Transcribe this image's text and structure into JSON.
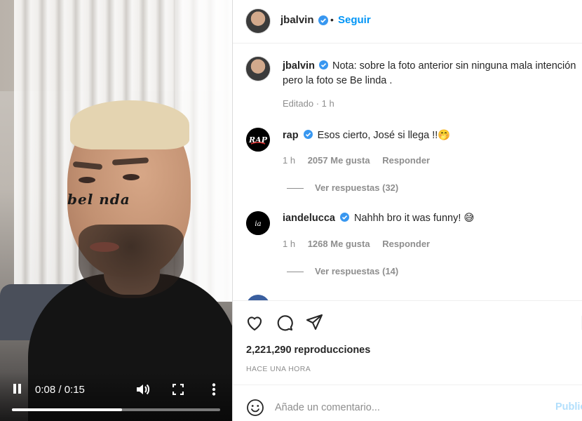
{
  "video": {
    "time_label": "0:08 / 0:15",
    "progress": 0.53,
    "face_text": "bel  nda"
  },
  "header": {
    "username": "jbalvin",
    "separator": "•",
    "follow_label": "Seguir"
  },
  "caption": {
    "username": "jbalvin",
    "text": "Nota: sobre la foto anterior sin ninguna mala intención pero la foto se Be linda .",
    "meta": "Editado · 1 h"
  },
  "comments": [
    {
      "username": "rap",
      "text": "Esos cierto, José si llega !!🤭",
      "time": "1 h",
      "likes": "2057 Me gusta",
      "reply_label": "Responder",
      "view_replies": "Ver respuestas (32)",
      "avatar_text": "RAP"
    },
    {
      "username": "iandelucca",
      "text": "Nahhh bro it was funny! 😅",
      "time": "1 h",
      "likes": "1268 Me gusta",
      "reply_label": "Responder",
      "view_replies": "Ver respuestas (14)",
      "avatar_text": "ia"
    }
  ],
  "stats": {
    "views": "2,221,290 reproducciones",
    "posted": "HACE UNA HORA"
  },
  "add_comment": {
    "placeholder": "Añade un comentario...",
    "publish_label": "Publicar"
  },
  "colors": {
    "link_blue": "#0095f6",
    "verified_blue": "#3897f0",
    "muted": "#8e8e8e",
    "publish_disabled": "#b2dffc"
  },
  "icons": [
    "play-pause-icon",
    "volume-icon",
    "fullscreen-icon",
    "more-vertical-icon",
    "verified-icon",
    "heart-icon",
    "comment-icon",
    "share-icon",
    "save-icon",
    "emoji-icon"
  ]
}
